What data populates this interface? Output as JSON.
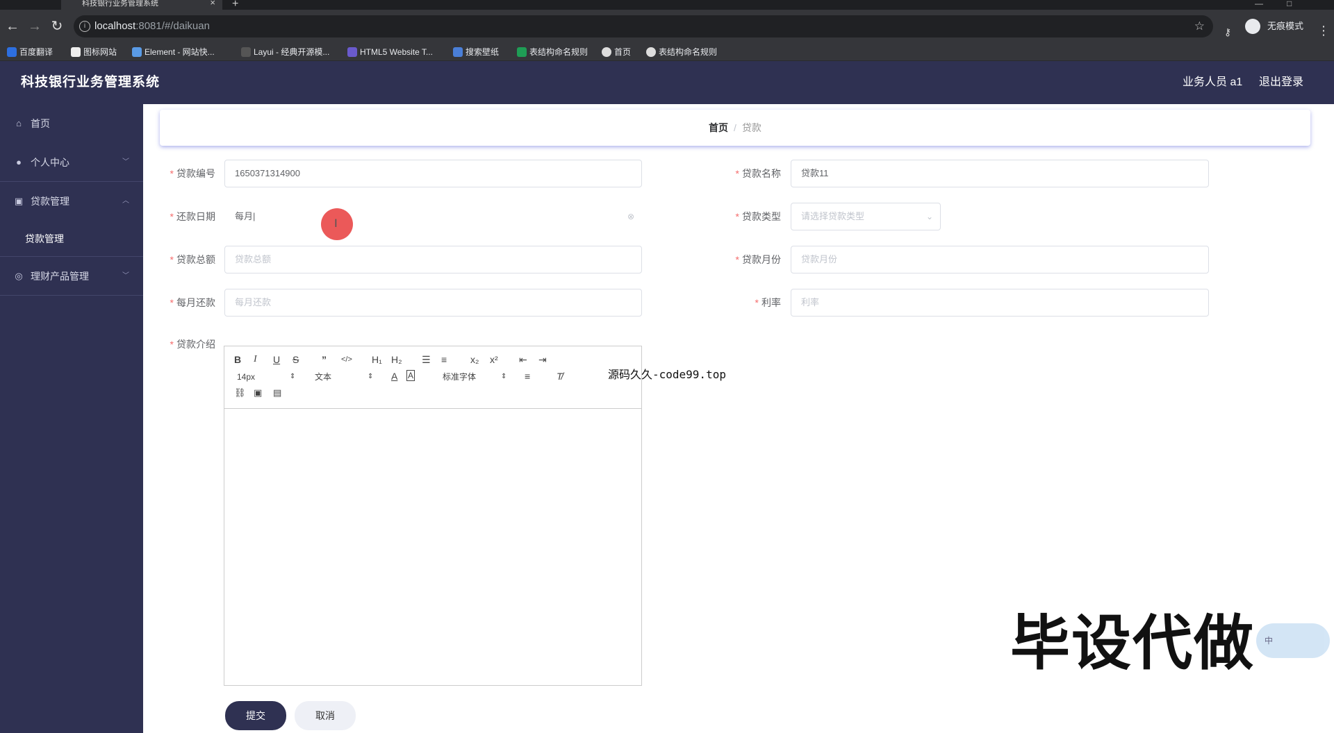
{
  "browser": {
    "tab_title": "科技银行业务管理系统",
    "url_host": "localhost",
    "url_rest": ":8081/#/daikuan",
    "incognito_label": "无痕模式",
    "bookmarks": [
      "百度翻译",
      "图标网站",
      "Element - 网站快...",
      "Layui - 经典开源模...",
      "HTML5 Website T...",
      "搜索壁纸",
      "表结构命名规则",
      "首页",
      "表结构命名规则"
    ]
  },
  "header": {
    "title": "科技银行业务管理系统",
    "user": "业务人员 a1",
    "logout": "退出登录"
  },
  "sidebar": {
    "items": [
      {
        "label": "首页"
      },
      {
        "label": "个人中心"
      },
      {
        "label": "贷款管理"
      },
      {
        "label": "贷款管理"
      },
      {
        "label": "理财产品管理"
      }
    ]
  },
  "breadcrumb": {
    "home": "首页",
    "sep": "/",
    "current": "贷款"
  },
  "form": {
    "loan_no": {
      "label": "贷款编号",
      "value": "1650371314900"
    },
    "loan_name": {
      "label": "贷款名称",
      "value": "贷款11"
    },
    "repay_date": {
      "label": "还款日期",
      "value": "每月|"
    },
    "loan_type": {
      "label": "贷款类型",
      "placeholder": "请选择贷款类型"
    },
    "loan_total": {
      "label": "贷款总额",
      "placeholder": "贷款总额"
    },
    "loan_months": {
      "label": "贷款月份",
      "placeholder": "贷款月份"
    },
    "monthly_repay": {
      "label": "每月还款",
      "placeholder": "每月还款"
    },
    "rate": {
      "label": "利率",
      "placeholder": "利率"
    },
    "intro": {
      "label": "贷款介绍"
    }
  },
  "editor_toolbar": {
    "h1": "H₁",
    "h2": "H₂",
    "sub": "x₂",
    "sup": "x²",
    "font_size": "14px",
    "text_style": "文本",
    "font_family": "标准字体"
  },
  "buttons": {
    "submit": "提交",
    "cancel": "取消"
  },
  "overlay": {
    "source_text": "源码久久-code99.top",
    "banner": "毕设代做",
    "ime": "中"
  },
  "colors": {
    "sidebar_bg": "#2f3152",
    "required": "#f56c6c"
  }
}
